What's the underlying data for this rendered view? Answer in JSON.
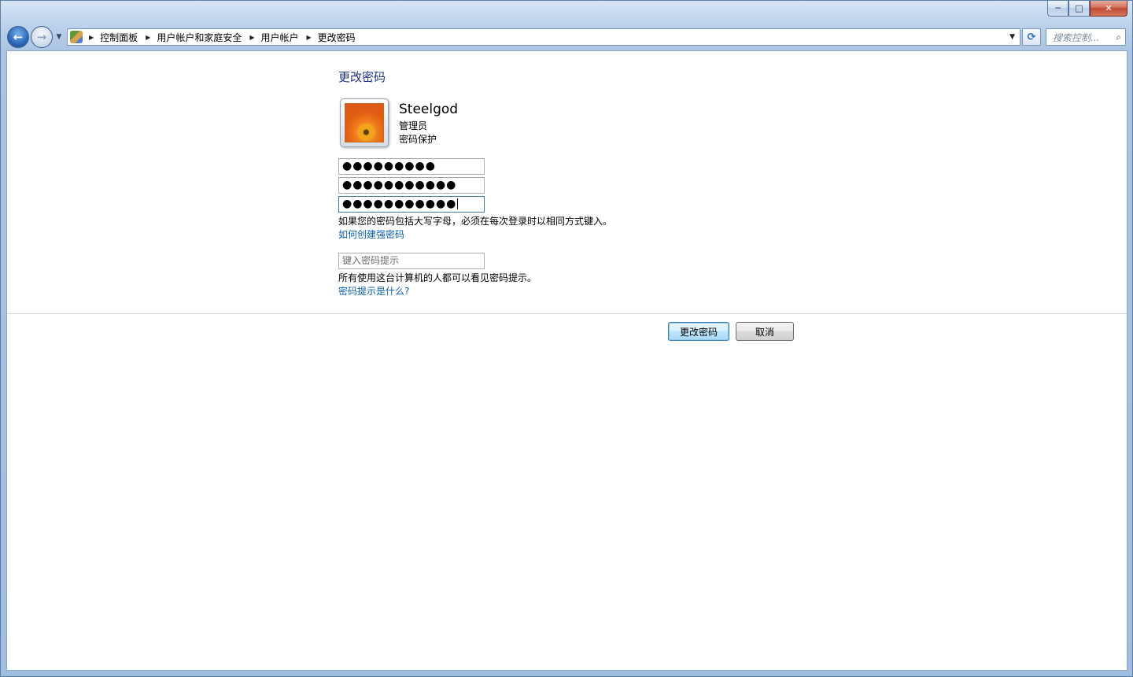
{
  "window": {
    "minimize_glyph": "─",
    "maximize_glyph": "□",
    "close_glyph": "✕"
  },
  "navigation": {
    "back_glyph": "←",
    "forward_glyph": "→",
    "breadcrumbs": [
      "控制面板",
      "用户帐户和家庭安全",
      "用户帐户",
      "更改密码"
    ],
    "search_placeholder": "搜索控制...",
    "refresh_glyph": "⟳"
  },
  "page": {
    "title": "更改密码",
    "user": {
      "name": "Steelgod",
      "role": "管理员",
      "status": "密码保护"
    },
    "fields": {
      "current_password": "●●●●●●●●●",
      "new_password": "●●●●●●●●●●●",
      "confirm_password": "●●●●●●●●●●●"
    },
    "caps_note": "如果您的密码包括大写字母，必须在每次登录时以相同方式键入。",
    "strong_password_link": "如何创建强密码",
    "hint_placeholder": "键入密码提示",
    "hint_note": "所有使用这台计算机的人都可以看见密码提示。",
    "hint_link": "密码提示是什么?"
  },
  "buttons": {
    "change": "更改密码",
    "cancel": "取消"
  }
}
